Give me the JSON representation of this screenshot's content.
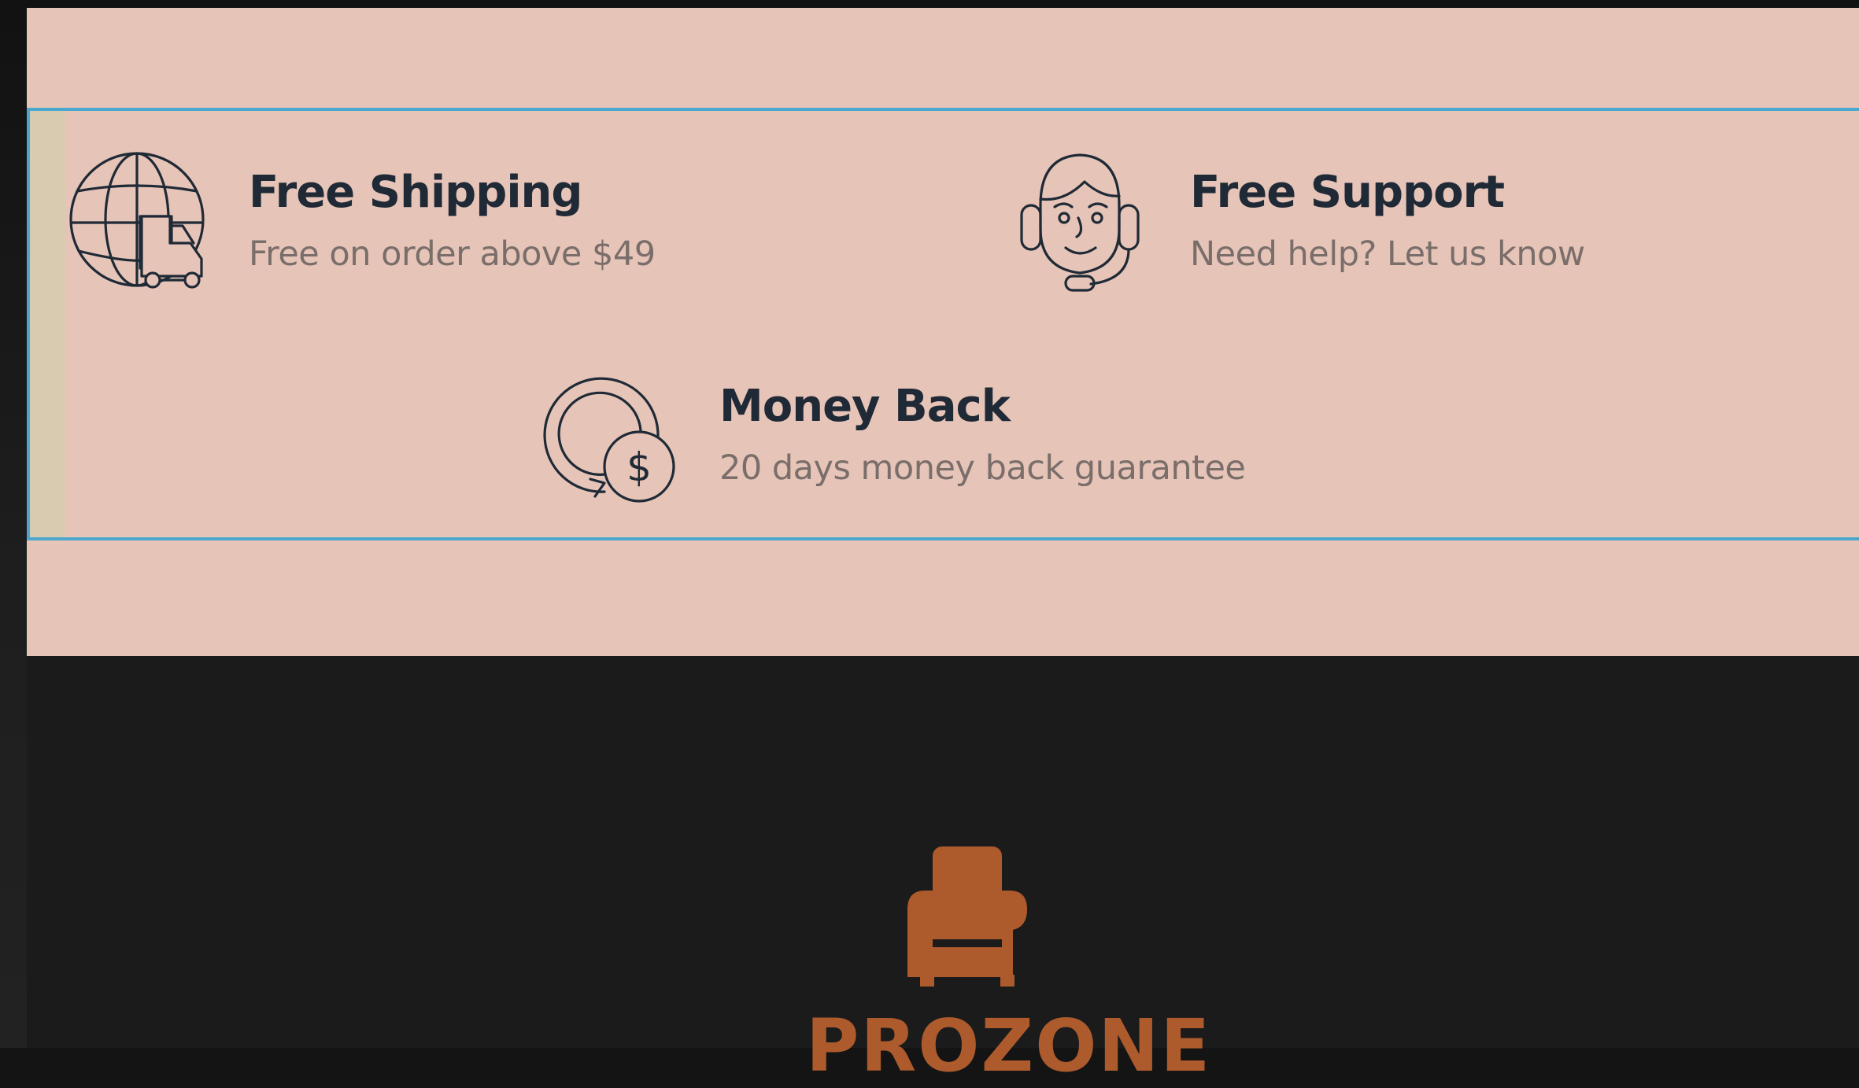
{
  "features": [
    {
      "title": "Free Shipping",
      "subtitle": "Free on order above $49",
      "icon": "globe-truck-icon"
    },
    {
      "title": "Free Support",
      "subtitle": "Need help? Let us know",
      "icon": "support-agent-icon"
    },
    {
      "title": "Money Back",
      "subtitle": "20 days money back guarantee",
      "icon": "money-back-icon"
    }
  ],
  "footer": {
    "brand_name": "PROZONE",
    "logo_icon": "armchair-icon"
  },
  "colors": {
    "section_bg": "#e6c4b8",
    "title_text": "#1f2a36",
    "subtitle_text": "#7a6e6a",
    "footer_bg": "#1b1b1b",
    "brand_accent": "#ad5a2c",
    "selection_outline": "#4aa8cf"
  }
}
